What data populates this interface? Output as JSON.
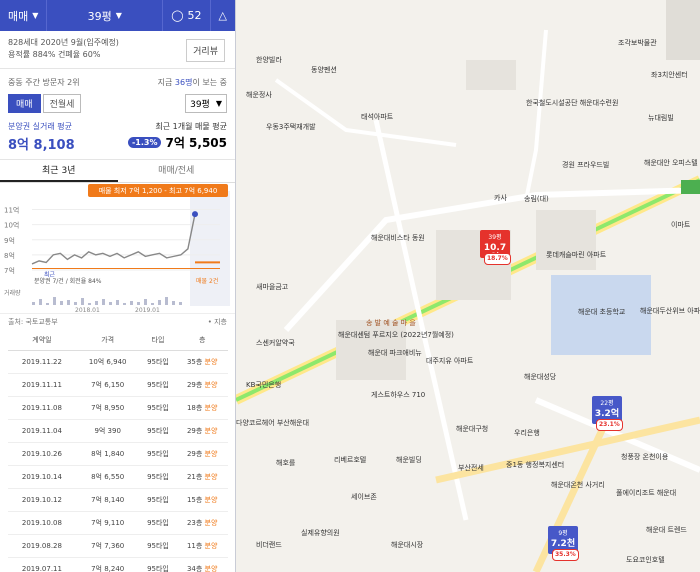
{
  "header": {
    "trade_type": "매매",
    "area": "39평",
    "comment_count": "52"
  },
  "info": {
    "line1": "828세대   2020년 9월(입주예정)",
    "line2": "용적률 884%  건폐율 60%",
    "review_btn": "거리뷰"
  },
  "rank": {
    "left": "중동 주간 방문자 2위",
    "right_prefix": "지금 ",
    "right_bold": "36명",
    "right_suffix": "이 보는 중",
    "tab_sale": "매매",
    "tab_jeonse": "전월세",
    "select": "39평"
  },
  "price": {
    "left_label": "분양권 실거래 평균",
    "left_value": "8억 8,108",
    "right_label": "최근 1개월 매물 평균",
    "right_pct": "-1.3%",
    "right_value": "7억 5,505"
  },
  "tabs": [
    "최근 3년",
    "매매/전세"
  ],
  "chart": {
    "tooltip": "매물 최저 7억 1,200 - 최고 7억 6,940",
    "y_labels": [
      "11억",
      "10억",
      "9억",
      "8억",
      "7억"
    ],
    "x_labels": [
      "2018.01",
      "2019.01"
    ],
    "note_left": "분양권 7/건 / 회전율 84%",
    "note_right": "매물 2건",
    "bottom_left": "거래량",
    "point_label": "최근"
  },
  "chart_data": {
    "type": "line",
    "series": [
      {
        "values": [
          7.4,
          7.6,
          7.5,
          8.0,
          8.1,
          7.7,
          8.0,
          7.8,
          8.2,
          8.0,
          8.1,
          7.9,
          8.1,
          7.8,
          8.0,
          8.2,
          7.9,
          8.0,
          8.1,
          7.8,
          7.9,
          8.0,
          8.4,
          10.7
        ]
      }
    ],
    "ylim": [
      6.8,
      11.3
    ]
  },
  "table": {
    "source": "출처: 국토교통부",
    "source_right": "• 지층",
    "headers": [
      "계약일",
      "가격",
      "타입",
      "층"
    ],
    "rows": [
      [
        "2019.11.22",
        "10억 6,940",
        "95타입",
        "35층",
        "분양"
      ],
      [
        "2019.11.11",
        "7억 6,150",
        "95타입",
        "29층",
        "분양"
      ],
      [
        "2019.11.08",
        "7억 8,950",
        "95타입",
        "18층",
        "분양"
      ],
      [
        "2019.11.04",
        "9억 390",
        "95타입",
        "29층",
        "분양"
      ],
      [
        "2019.10.26",
        "8억 1,840",
        "95타입",
        "29층",
        "분양"
      ],
      [
        "2019.10.14",
        "8억 6,550",
        "95타입",
        "21층",
        "분양"
      ],
      [
        "2019.10.12",
        "7억 8,140",
        "95타입",
        "15층",
        "분양"
      ],
      [
        "2019.10.08",
        "7억 9,110",
        "95타입",
        "23층",
        "분양"
      ],
      [
        "2019.08.28",
        "7억 7,360",
        "95타입",
        "11층",
        "분양"
      ],
      [
        "2019.07.11",
        "7억 8,240",
        "95타입",
        "34층",
        "분양"
      ]
    ]
  },
  "map": {
    "labels": [
      "한양빌라",
      "동양펜션",
      "해운정사",
      "태석아파트",
      "한국철도시설공단 해운대수련원",
      "조각보박물관",
      "좌3치안센터",
      "뉴대림빌",
      "경원 프라우드빌",
      "해운대안 오피스텔",
      "우동3주택재개발",
      "카사",
      "송림(대)",
      "해운대비스타 동원",
      "롯데캐슬마린 아파트",
      "이마트",
      "해운대 초등학교",
      "해운대두산위브 아파트",
      "새마을금고",
      "송 발 예 술 마 을",
      "해운대센텀 푸르지오 (2022년7월예정)",
      "해운대 파크애비뉴",
      "대주지유 아파트",
      "해운대성당",
      "스센커알약국",
      "KB국민은행",
      "게스트하우스 710",
      "해운대구청",
      "우리은행",
      "다양코르헤어 부산해운대",
      "리베르호텔",
      "해운빌딩",
      "부산전세",
      "중1동 행정복지센터",
      "해운대온천 사거리",
      "청풍장 온천이용",
      "풀에이리조트 해운대",
      "세이브존",
      "해호를",
      "비더랜드",
      "실제유향의원",
      "해운대시장",
      "도요코인호텔",
      "해운대 트렌드"
    ],
    "pin_top": {
      "sub": "39평",
      "value": "10.7억",
      "pct": "18.7%"
    },
    "pin_mid": {
      "sub": "22평",
      "value": "3.2억",
      "pct": "23.1%"
    },
    "pin_bot": {
      "sub": "9평",
      "value": "7.2천",
      "pct": "35.3%"
    }
  }
}
